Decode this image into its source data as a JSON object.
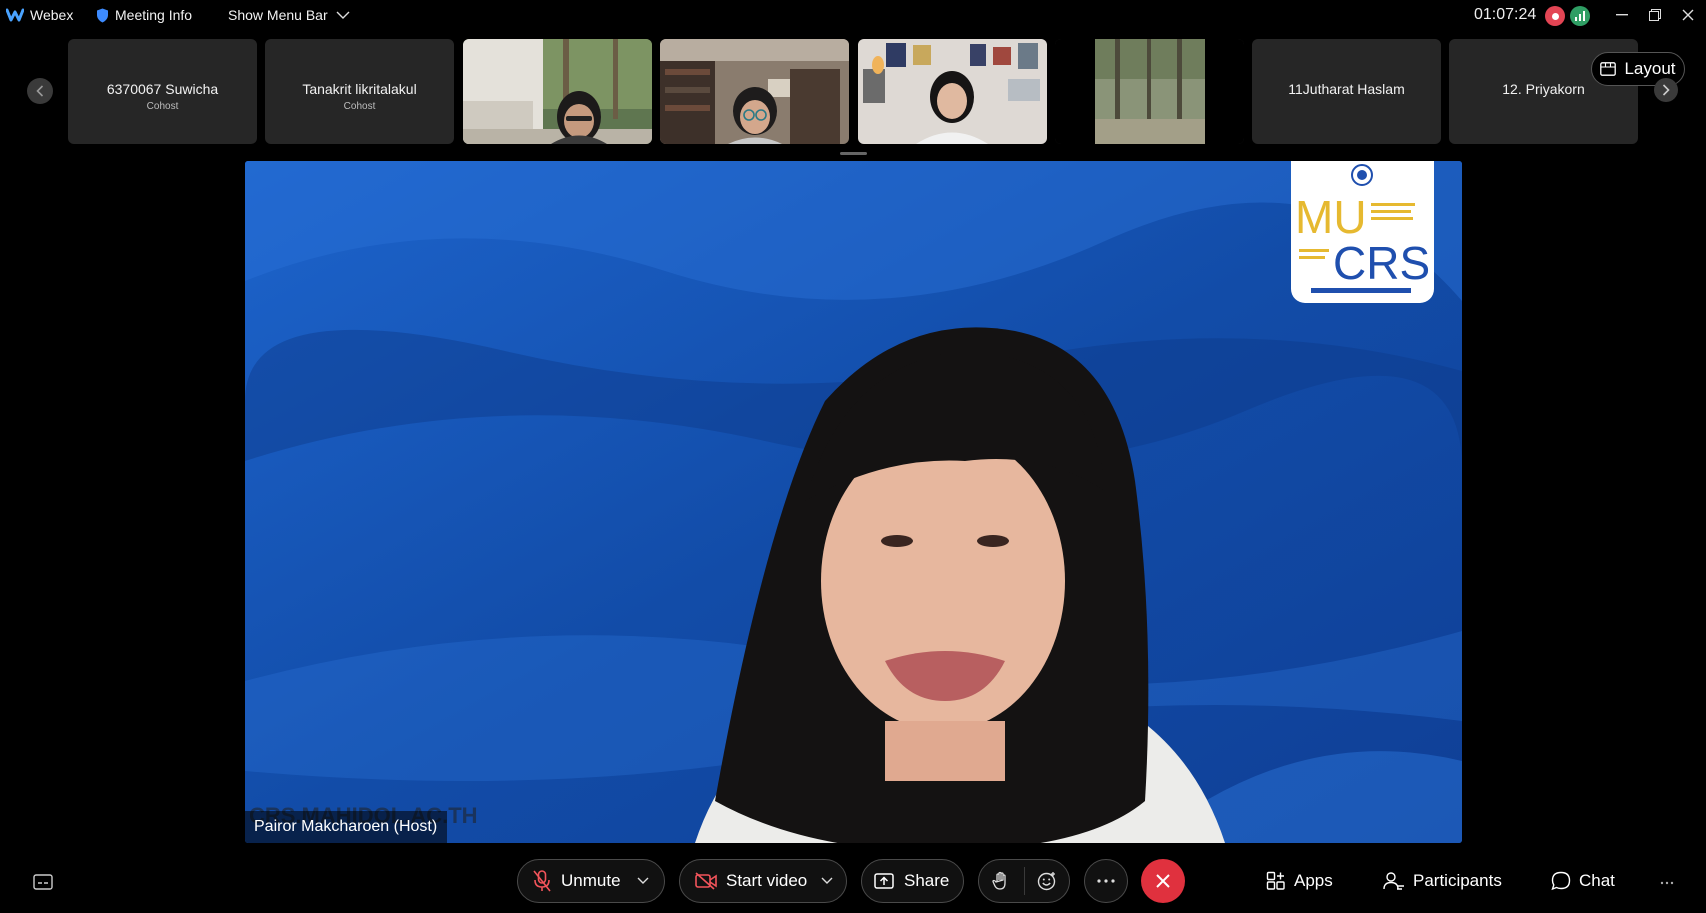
{
  "titlebar": {
    "app_name": "Webex",
    "meeting_info": "Meeting Info",
    "show_menu_bar": "Show Menu Bar",
    "elapsed_time": "01:07:24"
  },
  "filmstrip": {
    "tiles": [
      {
        "name": "6370067 Suwicha",
        "role": "Cohost"
      },
      {
        "name": "Tanakrit likritalakul",
        "role": "Cohost"
      },
      {
        "name": "",
        "role": ""
      },
      {
        "name": "",
        "role": ""
      },
      {
        "name": "",
        "role": ""
      },
      {
        "name": "",
        "role": ""
      },
      {
        "name": "11Jutharat Haslam",
        "role": ""
      },
      {
        "name": "12. Priyakorn",
        "role": ""
      }
    ],
    "layout_label": "Layout"
  },
  "stage": {
    "speaker_label": "Pairor Makcharoen (Host)",
    "watermark_text": "CRS.MAHIDOL.AC.TH",
    "badge": {
      "top": "MU",
      "bottom": "CRS"
    }
  },
  "controls": {
    "unmute": "Unmute",
    "start_video": "Start video",
    "share": "Share",
    "apps": "Apps",
    "participants": "Participants",
    "chat": "Chat"
  },
  "colors": {
    "end_call": "#e0313e",
    "recording": "#e34554",
    "network": "#2f9e64",
    "badge_gold": "#e6b930",
    "badge_blue": "#1f4fae"
  }
}
